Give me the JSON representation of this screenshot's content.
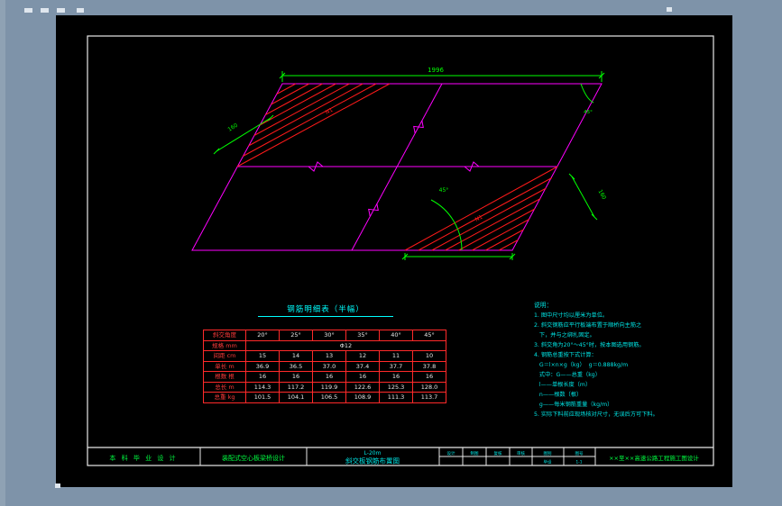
{
  "drawing": {
    "dim_top": "1996",
    "dim_left": "160",
    "dim_right": "160",
    "angle_bottom": "45°",
    "angle_top_right": "45°",
    "bar_label_top": "N1",
    "bar_label_bottom": "N1"
  },
  "table": {
    "title": "钢筋明细表（半幅）",
    "corner_label": "斜交角度",
    "angle_headers": [
      "20°",
      "25°",
      "30°",
      "35°",
      "40°",
      "45°"
    ],
    "spec_label": "规格 mm",
    "spec_value": "Φ12",
    "rows": [
      {
        "label": "间距 cm",
        "values": [
          "15",
          "14",
          "13",
          "12",
          "11",
          "10"
        ]
      },
      {
        "label": "单长 m",
        "values": [
          "36.9",
          "36.5",
          "37.0",
          "37.4",
          "37.7",
          "37.8"
        ]
      },
      {
        "label": "根数 根",
        "values": [
          "16",
          "16",
          "16",
          "16",
          "16",
          "16"
        ]
      },
      {
        "label": "总长 m",
        "values": [
          "114.3",
          "117.2",
          "119.9",
          "122.6",
          "125.3",
          "128.0"
        ]
      },
      {
        "label": "总重 kg",
        "values": [
          "101.5",
          "104.1",
          "106.5",
          "108.9",
          "111.3",
          "113.7"
        ]
      }
    ]
  },
  "notes": {
    "title": "说明：",
    "lines": [
      "1. 图中尺寸均以厘米为单位。",
      "2. 斜交钢筋应平行板端布置于顺桥向主筋之",
      "   下，并与之绑扎固定。",
      "3. 斜交角为20°～45°时，按本图选用钢筋。",
      "4. 钢筋总重按下式计算：",
      "   G＝l×n×g（kg）  g＝0.888kg/m",
      "   式中：G——总重（kg）",
      "   l——单根长度（m）",
      "   n——根数（根）",
      "   g——每米钢筋重量（kg/m）",
      "5. 实际下料前应现场核对尺寸，无误后方可下料。"
    ]
  },
  "titleblock": {
    "cell1": "本 科 毕 业 设 计",
    "cell2": "装配式空心板梁桥设计",
    "center_top": "L-20m",
    "center_bottom": "斜交板钢筋布置图",
    "grid_a": {
      "r1": [
        "设计",
        "制图",
        "复核",
        "审核"
      ]
    },
    "grid_b": {
      "r1c1": "图别",
      "r1c2": "图号",
      "r2c1": "毕设",
      "r2c2": "1-1"
    },
    "project": "××至××高速公路工程施工图设计"
  },
  "colors": {
    "outline": "#ff00ff",
    "rebar": "#ff1a1a",
    "dimension": "#00ff00",
    "text": "#00ffff",
    "frame": "#e8e8e8"
  }
}
